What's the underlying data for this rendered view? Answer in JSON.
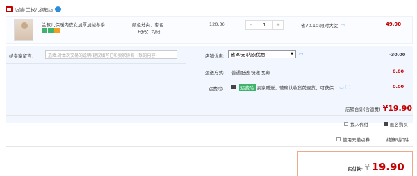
{
  "shop": {
    "label": "店铺:",
    "name": "兰叔儿旗舰店"
  },
  "item": {
    "title": "兰叔儿保暖内衣女加厚加绒冬季...",
    "attr_color": "颜色分类：杏色",
    "attr_size": "尺码：均码",
    "unit_price": "120.00",
    "qty": "1",
    "qty_minus": "-",
    "qty_plus": "+",
    "promo": "省70.10:限时大促",
    "subtotal": "49.90"
  },
  "message": {
    "label": "给卖家留言：",
    "placeholder": "选填:对本次交易的说明(建议填写已和卖家协商一致的内容)"
  },
  "coupon": {
    "label": "店铺优惠:",
    "selected": "省30元:内衣优惠",
    "amount": "-30.00"
  },
  "shipping": {
    "label": "运送方式:",
    "value": "普通配送 快递 免邮",
    "amount": "0.00"
  },
  "insurance": {
    "label": "运费险:",
    "badge": "运费险",
    "text": "卖家赠送，若确认收货前退货，可获保...",
    "amount": "0.00"
  },
  "shop_total": {
    "label": "店铺合计(含运费)",
    "amount": "¥19.90"
  },
  "options": {
    "proxy": "找人代付",
    "anonymous": "匿名购买",
    "tmall_coupon": "使用天猫点券",
    "points": "结算时扣除"
  },
  "pay": {
    "label": "实付款:",
    "amount": "19.90",
    "currency": "¥"
  },
  "colors": {
    "accent": "#c40000",
    "order_bg": "#f2f7ff",
    "insurance_green": "#3db36b"
  }
}
